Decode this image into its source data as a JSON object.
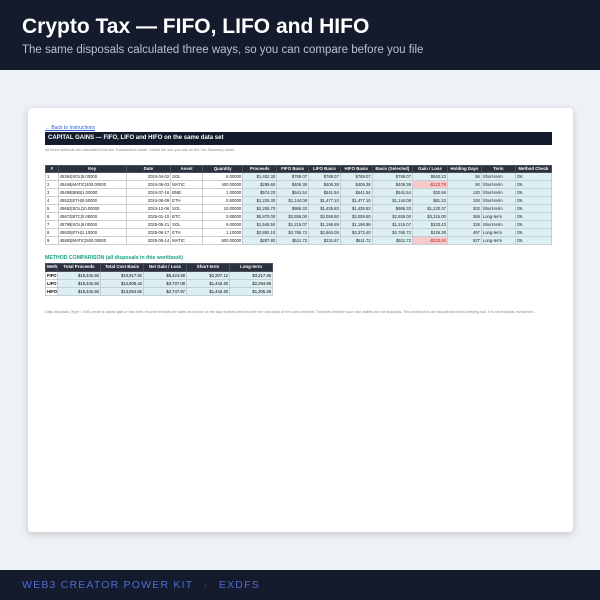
{
  "header": {
    "title": "Crypto Tax — FIFO, LIFO and HIFO",
    "subtitle": "The same disposals calculated three ways, so you can compare before you file"
  },
  "sheet": {
    "back_link": "← Back to Instructions",
    "title": "CAPITAL GAINS — FIFO, LIFO and HIFO on the same data set",
    "subtitle": "All three methods are calculated from the Transactions sheet. Select the one you use on the Tax Summary sheet.",
    "columns": [
      "#",
      "Key",
      "Date",
      "Asset",
      "Quantity",
      "Proceeds",
      "FIFO Basis",
      "LIFO Basis",
      "HIFO Basis",
      "Basis (Selected)",
      "Gain / Loss",
      "Holding Days",
      "Term",
      "Method Check"
    ],
    "rows": [
      {
        "n": "1",
        "key": "45384|SOL|8.00000",
        "date": "2024-04-02",
        "asset": "SOL",
        "qty": "8.00000",
        "proceeds": "$1,452.30",
        "fifo": "$789.07",
        "lifo": "$789.07",
        "hifo": "$789.07",
        "sel": "$789.07",
        "gain": "$663.23",
        "days": "56",
        "term": "Short-term",
        "check": "OK",
        "neg": false
      },
      {
        "n": "2",
        "key": "45446|MATIC|400.00000",
        "date": "2024-06-03",
        "asset": "MATIC",
        "qty": "400.00000",
        "proceeds": "$285.60",
        "fifo": "$409.38",
        "lifo": "$409.38",
        "hifo": "$409.38",
        "sel": "$409.38",
        "gain": "-$123.78",
        "days": "90",
        "term": "Short-term",
        "check": "OK",
        "neg": true
      },
      {
        "n": "3",
        "key": "45489|BNB|1.00000",
        "date": "2024-07-16",
        "asset": "BNB",
        "qty": "1.00000",
        "proceeds": "$574.20",
        "fifo": "$541.54",
        "lifo": "$541.54",
        "hifo": "$541.54",
        "sel": "$541.54",
        "gain": "$32.66",
        "days": "120",
        "term": "Short-term",
        "check": "OK",
        "neg": false
      },
      {
        "n": "4",
        "key": "45522|ETH|0.50000",
        "date": "2024-08-09",
        "asset": "ETH",
        "qty": "0.50000",
        "proceeds": "$1,225.30",
        "fifo": "$1,144.08",
        "lifo": "$1,477.10",
        "hifo": "$1,477.10",
        "sel": "$1,144.08",
        "gain": "$81.22",
        "days": "193",
        "term": "Short-term",
        "check": "OK",
        "neg": false
      },
      {
        "n": "5",
        "key": "45652|SOL|10.00000",
        "date": "2024-12-06",
        "asset": "SOL",
        "qty": "10.00000",
        "proceeds": "$2,206.70",
        "fifo": "$986.33",
        "lifo": "$1,435.83",
        "hifo": "$1,435.83",
        "sel": "$986.33",
        "gain": "$1,220.37",
        "days": "302",
        "term": "Short-term",
        "check": "OK",
        "neg": false
      },
      {
        "n": "6",
        "key": "45672|BTC|0.08000",
        "date": "2025-01-10",
        "asset": "BTC",
        "qty": "0.08000",
        "proceeds": "$5,870.00",
        "fifo": "$2,555.00",
        "lifo": "$3,059.50",
        "hifo": "$3,059.50",
        "sel": "$2,555.00",
        "gain": "$3,315.00",
        "days": "369",
        "term": "Long-term",
        "check": "OK",
        "neg": false
      },
      {
        "n": "7",
        "key": "45798|SOL|9.00000",
        "date": "2025-05-21",
        "asset": "SOL",
        "qty": "9.00000",
        "proceeds": "$1,548.50",
        "fifo": "$1,215.07",
        "lifo": "$1,196.89",
        "hifo": "$1,196.89",
        "sel": "$1,215.07",
        "gain": "$333.43",
        "days": "328",
        "term": "Short-term",
        "check": "OK",
        "neg": false
      },
      {
        "n": "8",
        "key": "45825|ETH|1.10000",
        "date": "2025-06-17",
        "asset": "ETH",
        "qty": "1.10000",
        "proceeds": "$2,892.10",
        "fifo": "$2,765.72",
        "lifo": "$2,664.05",
        "hifo": "$3,373.40",
        "sel": "$2,765.72",
        "gain": "$126.38",
        "days": "497",
        "term": "Long-term",
        "check": "OK",
        "neg": false
      },
      {
        "n": "9",
        "key": "45883|MATIC|500.00000",
        "date": "2025-08-14",
        "asset": "MATIC",
        "qty": "500.00000",
        "proceeds": "$287.80",
        "fifo": "$511.72",
        "lifo": "$231.67",
        "hifo": "$511.72",
        "sel": "$511.72",
        "gain": "-$223.92",
        "days": "527",
        "term": "Long-term",
        "check": "OK",
        "neg": true
      }
    ]
  },
  "comparison": {
    "title": "METHOD COMPARISON (all disposals in this workbook)",
    "columns": [
      "Method",
      "Total Proceeds",
      "Total Cost Basis",
      "Net Gain / Loss",
      "Short-term",
      "Long-term"
    ],
    "rows": [
      {
        "method": "FIFO",
        "proceeds": "$16,342.50",
        "basis": "$10,917.92",
        "net": "$5,424.58",
        "short": "$2,207.12",
        "long": "$3,217.46"
      },
      {
        "method": "LIFO",
        "proceeds": "$16,342.50",
        "basis": "$12,605.42",
        "net": "$3,737.08",
        "short": "$1,442.40",
        "long": "$2,294.69"
      },
      {
        "method": "HIFO",
        "proceeds": "$16,342.50",
        "basis": "$13,594.82",
        "net": "$2,747.67",
        "short": "$1,442.40",
        "long": "$1,305.28"
      }
    ]
  },
  "note": "Daily disposals (Type = Sell) create a capital gain or loss here. Income receipts are taxed as income on the day received and become the cost basis of the coins received. Transfers between your own wallets are not disposals. This workbook is an educational record-keeping tool. It is not financial, investment...",
  "footer": {
    "brand": "WEB3 CREATOR POWER KIT",
    "separator": "·",
    "author": "EXDFS"
  }
}
